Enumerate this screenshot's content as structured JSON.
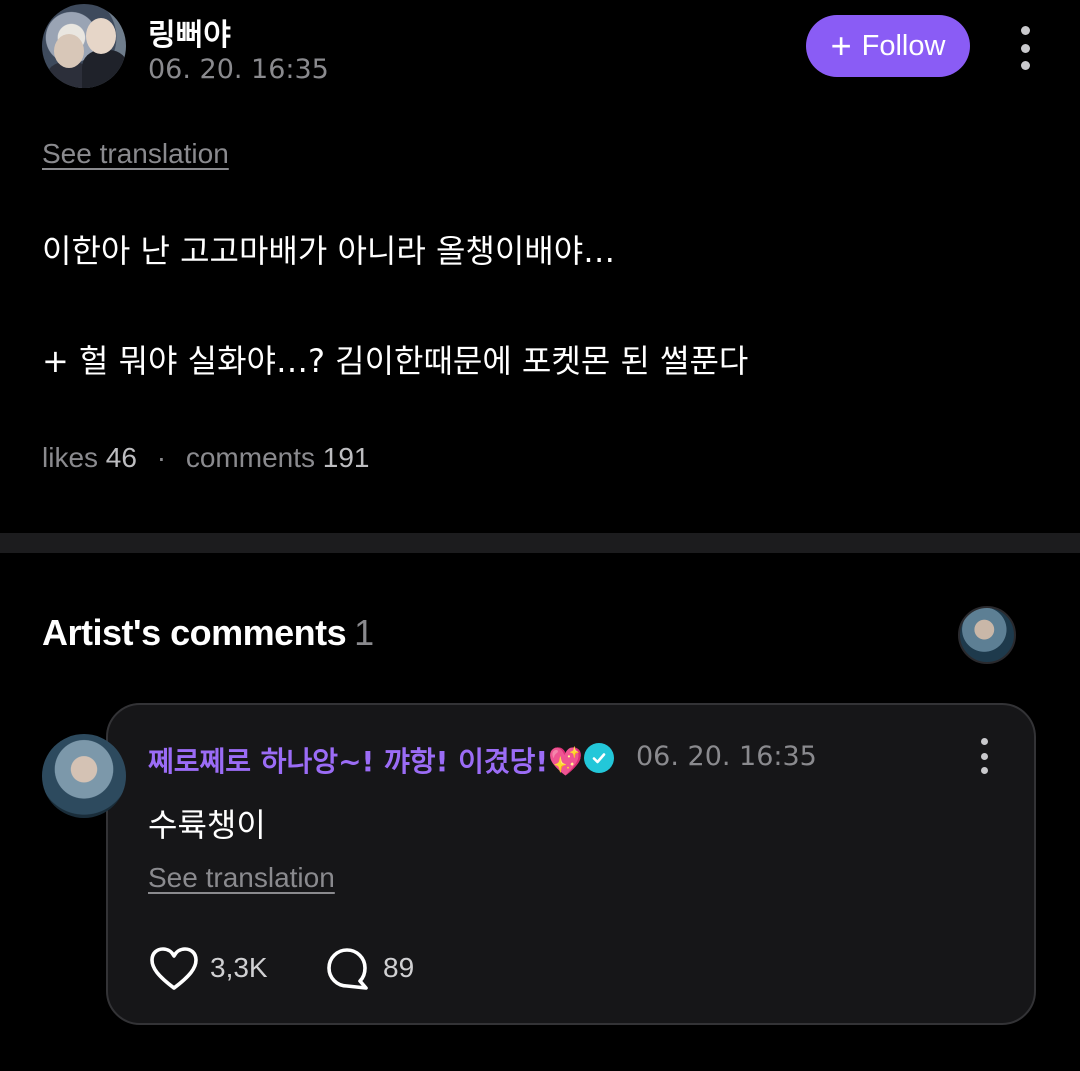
{
  "post": {
    "username": "링뻐야",
    "timestamp": "06. 20. 16:35",
    "follow_label": "Follow",
    "see_translation": "See translation",
    "body_line1": "이한아 난 고고마배가 아니라 올챙이배야…",
    "body_line2": "+ 헐 뭐야 실화야…? 김이한때문에 포켓몬 된 썰푼다",
    "likes_label": "likes",
    "likes_count": "46",
    "separator": "·",
    "comments_label": "comments",
    "comments_count": "191"
  },
  "artist_comments": {
    "title": "Artist's comments",
    "count": "1",
    "comment": {
      "author": "쩨로쩨로 하나앙~! 꺄항! 이겼당!💖",
      "timestamp": "06. 20. 16:35",
      "text": "수륙챙이",
      "see_translation": "See translation",
      "likes": "3,3K",
      "replies": "89"
    }
  },
  "icons": {
    "more": "more-vertical-icon",
    "verified": "verified-badge-icon",
    "like": "heart-outline-icon",
    "reply": "speech-bubble-icon",
    "add": "plus-icon"
  },
  "colors": {
    "background": "#000000",
    "accent": "#8a5cf5",
    "artist_name": "#9b6cf6",
    "verified": "#23c7d9",
    "muted_text": "#8a8a8e",
    "card_bg": "#161618"
  }
}
